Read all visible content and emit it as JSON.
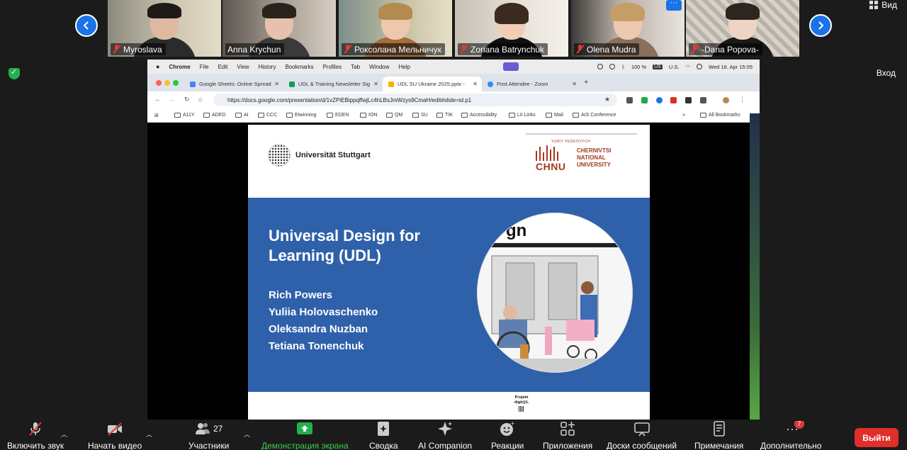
{
  "participants": [
    {
      "name": "Myroslava",
      "muted": true
    },
    {
      "name": "Anna Krychun",
      "muted": false
    },
    {
      "name": "Роксолана Мельничук",
      "muted": true
    },
    {
      "name": "Zoriana Batrynchuk",
      "muted": true
    },
    {
      "name": "Olena Mudra",
      "muted": true
    },
    {
      "name": "-Dana Popova-",
      "muted": true
    }
  ],
  "header": {
    "view_label": "Вид",
    "exit_label": "Вход",
    "more_tiles": "···"
  },
  "mac_menu": {
    "apple": "",
    "app": "Chrome",
    "items": [
      "File",
      "Edit",
      "View",
      "History",
      "Bookmarks",
      "Profiles",
      "Tab",
      "Window",
      "Help"
    ],
    "battery": "100 %",
    "input_source": "US",
    "input_label": "U.S.",
    "datetime": "Wed 16. Apr  15:05"
  },
  "browser": {
    "tabs": [
      {
        "title": "Google Sheets: Online Spread",
        "color": "#4285f4",
        "active": false
      },
      {
        "title": "UDL & Training Newsletter Sig",
        "color": "#0f9d58",
        "active": false
      },
      {
        "title": "UDL SU Ukraine 2025.pptx -",
        "color": "#f4b400",
        "active": true
      },
      {
        "title": "Post Attendee - Zoom",
        "color": "#2d8cff",
        "active": false
      }
    ],
    "url": "https://docs.google.com/presentation/d/1vZPiEBippqffwjLc4hLBsJmWzys9CmaH/edit#slide=id.p1",
    "bookmarks": [
      "A11Y",
      "ADED",
      "AI",
      "CCC",
      "Etwinning",
      "EDEN",
      "ION",
      "QM",
      "SU",
      "TIK",
      "Accessibility",
      "Lit Links",
      "Mail",
      "AIS Conference"
    ],
    "all_bookmarks": "All Bookmarks"
  },
  "slide": {
    "uni_left": "Universität Stuttgart",
    "chnu_sub": "YURIY FEDKOVYCH",
    "chnu_abbr": "CHNU",
    "chnu_line1": "CHERNIVTSI",
    "chnu_line2": "NATIONAL",
    "chnu_line3": "UNIVERSITY",
    "title": "Universal Design for Learning (UDL)",
    "authors": [
      "Rich Powers",
      "Yuliia Holovaschenko",
      "Oleksandra Nuzban",
      "Tetiana Tonenchuk"
    ],
    "image_sign": "gn",
    "footer_project": "Projekt digit@L"
  },
  "toolbar": {
    "audio": "Включить звук",
    "video": "Начать видео",
    "participants": "Участники",
    "participants_count": "27",
    "share": "Демонстрация экрана",
    "summary": "Сводка",
    "ai": "AI Companion",
    "reactions": "Реакции",
    "apps": "Приложения",
    "whiteboards": "Доски сообщений",
    "notes": "Примечания",
    "more": "Дополнительно",
    "more_badge": "7",
    "leave": "Выйти"
  }
}
